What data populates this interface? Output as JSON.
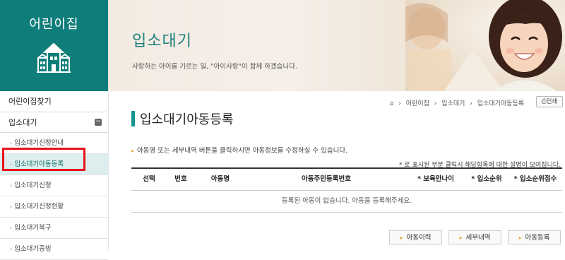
{
  "sidebar": {
    "title": "어린이집",
    "items": [
      {
        "label": "어린이집찾기"
      },
      {
        "label": "입소대기"
      }
    ],
    "subitems": [
      {
        "label": "입소대기신청안내"
      },
      {
        "label": "입소대기아동등록"
      },
      {
        "label": "입소대기신청"
      },
      {
        "label": "입소대기신청현황"
      },
      {
        "label": "입소대기복구"
      },
      {
        "label": "입소대기증빙"
      }
    ],
    "collapse_symbol": "−"
  },
  "banner": {
    "title": "입소대기",
    "subtitle": "사랑하는 아이를 기르는 일, \"아이사랑\"이 함께 하겠습니다."
  },
  "breadcrumb": {
    "items": [
      "어린이집",
      "입소대기",
      "입소대기아동등록"
    ],
    "separator": "›",
    "home_icon": "home-icon"
  },
  "print_label": "인쇄",
  "page_title": "입소대기아동등록",
  "notice": "아동명 또는 세부내역 버튼을 클릭하시면 아동정보를 수정하실 수 있습니다.",
  "table_note": "* 로 표시된 부분 클릭시 해당항목에 대한 설명이 보여집니다.",
  "table": {
    "headers": [
      "선택",
      "번호",
      "아동명",
      "아동주민등록번호",
      "* 보육만나이",
      "* 입소순위",
      "* 입소순위점수"
    ],
    "empty_message": "등록된 아동이 없습니다. 아동을 등록해주세요."
  },
  "actions": [
    {
      "label": "아동이력"
    },
    {
      "label": "세부내역"
    },
    {
      "label": "아동등록"
    }
  ],
  "colors": {
    "brand": "#0f7e7a",
    "active_bg": "#dcefee",
    "highlight": "#e8131b",
    "accent": "#e8a23a"
  }
}
